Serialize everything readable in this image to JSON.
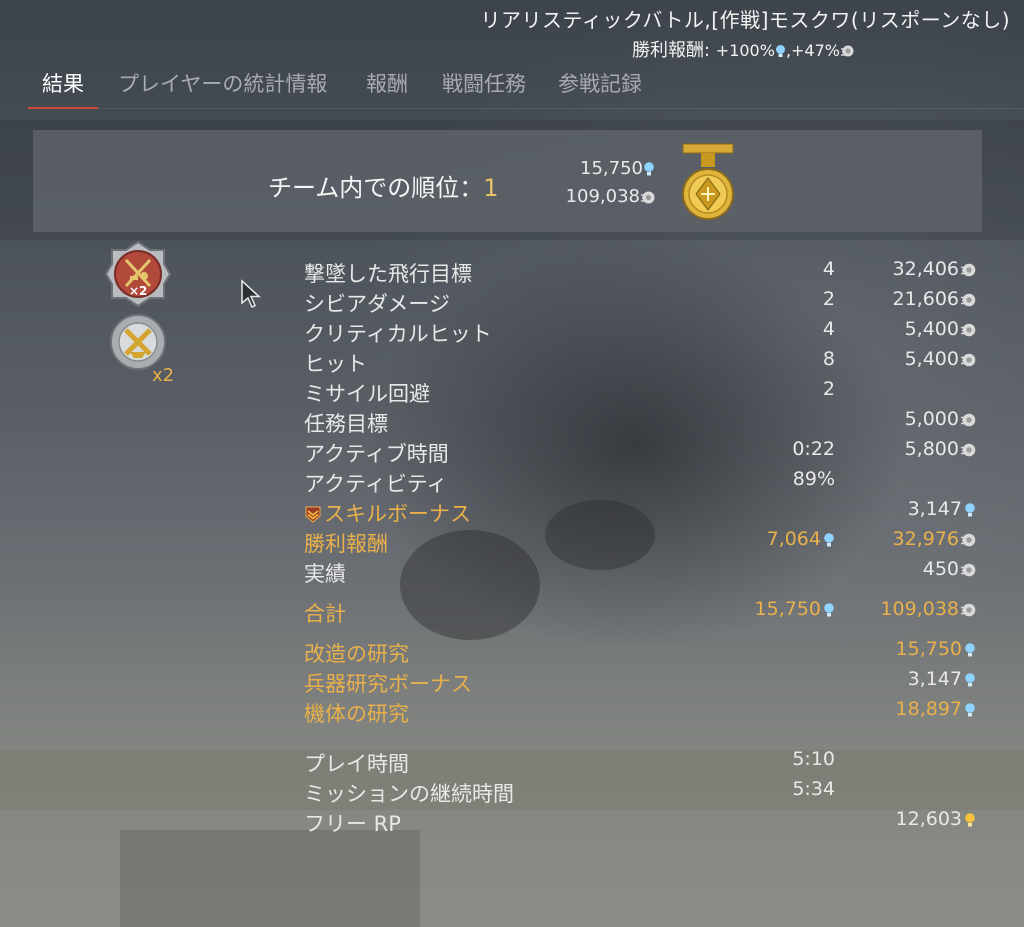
{
  "header": {
    "mission_title": "リアリスティックバトル,[作戦]モスクワ(リスポーンなし)",
    "victory_reward_label": "勝利報酬:",
    "victory_reward_rp": "+100%",
    "victory_reward_sl": ",+47%"
  },
  "tabs": [
    {
      "label": "結果",
      "active": true
    },
    {
      "label": "プレイヤーの統計情報",
      "active": false
    },
    {
      "label": "報酬",
      "active": false
    },
    {
      "label": "戦闘任務",
      "active": false
    },
    {
      "label": "参戦記録",
      "active": false
    }
  ],
  "rank_panel": {
    "label": "チーム内での順位：",
    "rank": "1",
    "rp": "15,750",
    "sl": "109,038"
  },
  "awards": {
    "first_multiplier": "×2",
    "second_multiplier": "x2"
  },
  "rows": [
    {
      "label": "撃墜した飛行目標",
      "count": "4",
      "value": "32,406",
      "icon": "sl"
    },
    {
      "label": "シビアダメージ",
      "count": "2",
      "value": "21,606",
      "icon": "sl"
    },
    {
      "label": "クリティカルヒット",
      "count": "4",
      "value": "5,400",
      "icon": "sl"
    },
    {
      "label": "ヒット",
      "count": "8",
      "value": "5,400",
      "icon": "sl"
    },
    {
      "label": "ミサイル回避",
      "count": "2",
      "value": "",
      "icon": ""
    },
    {
      "label": "任務目標",
      "count": "",
      "value": "5,000",
      "icon": "sl"
    },
    {
      "label": "アクティブ時間",
      "count": "0:22",
      "value": "5,800",
      "icon": "sl"
    },
    {
      "label": "アクティビティ",
      "count": "89%",
      "value": "",
      "icon": ""
    },
    {
      "label": "スキルボーナス",
      "count": "",
      "value": "3,147",
      "icon": "rp",
      "style": "gold-label"
    },
    {
      "label": "勝利報酬",
      "count": "7,064",
      "value": "32,976",
      "icon": "sl",
      "style": "gold-label",
      "count_icon": "rp"
    },
    {
      "label": "実績",
      "count": "",
      "value": "450",
      "icon": "sl"
    },
    {
      "label": "合計",
      "count": "15,750",
      "value": "109,038",
      "icon": "sl",
      "style": "gold-all",
      "count_icon": "rp"
    },
    {
      "label": "改造の研究",
      "count": "",
      "value": "15,750",
      "icon": "rp",
      "style": "gold-all"
    },
    {
      "label": "兵器研究ボーナス",
      "count": "",
      "value": "3,147",
      "icon": "rp",
      "style": "gold-label"
    },
    {
      "label": "機体の研究",
      "count": "",
      "value": "18,897",
      "icon": "rp",
      "style": "gold-all"
    },
    {
      "label": "プレイ時間",
      "count": "5:10",
      "value": "",
      "icon": ""
    },
    {
      "label": "ミッションの継続時間",
      "count": "5:34",
      "value": "",
      "icon": ""
    },
    {
      "label": "フリー RP",
      "count": "",
      "value": "12,603",
      "icon": "frp"
    }
  ],
  "colors": {
    "accent_gold": "#e9b04b",
    "tab_underline": "#d2493c",
    "rp_blue": "#8fd3ff",
    "free_rp_yellow": "#f3c43b"
  }
}
